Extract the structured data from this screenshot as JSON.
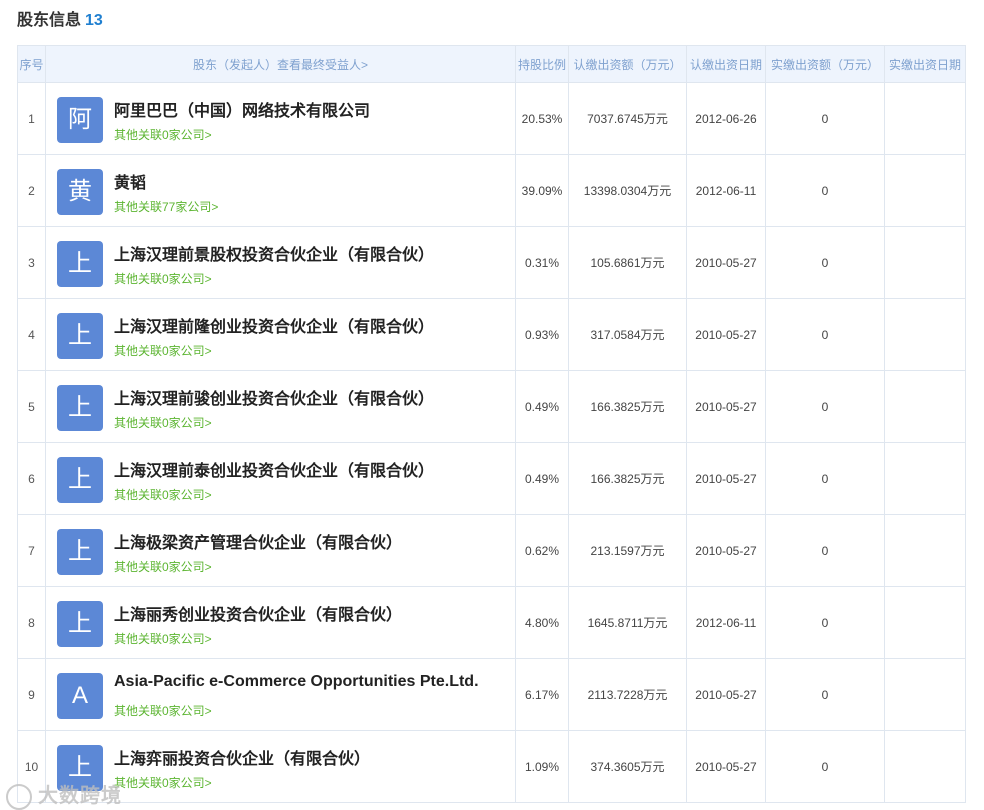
{
  "header": {
    "title": "股东信息",
    "count": "13"
  },
  "table": {
    "columns": [
      "序号",
      "股东（发起人）查看最终受益人>",
      "持股比例",
      "认缴出资额（万元）",
      "认缴出资日期",
      "实缴出资额（万元）",
      "实缴出资日期"
    ],
    "rows": [
      {
        "seq": "1",
        "avatar": "阿",
        "name": "阿里巴巴（中国）网络技术有限公司",
        "link": "其他关联0家公司>",
        "ratio": "20.53%",
        "amount": "7037.6745万元",
        "date": "2012-06-26",
        "paid": "0",
        "paid_date": ""
      },
      {
        "seq": "2",
        "avatar": "黄",
        "name": "黄韬",
        "link": "其他关联77家公司>",
        "ratio": "39.09%",
        "amount": "13398.0304万元",
        "date": "2012-06-11",
        "paid": "0",
        "paid_date": ""
      },
      {
        "seq": "3",
        "avatar": "上",
        "name": "上海汉理前景股权投资合伙企业（有限合伙）",
        "link": "其他关联0家公司>",
        "ratio": "0.31%",
        "amount": "105.6861万元",
        "date": "2010-05-27",
        "paid": "0",
        "paid_date": ""
      },
      {
        "seq": "4",
        "avatar": "上",
        "name": "上海汉理前隆创业投资合伙企业（有限合伙）",
        "link": "其他关联0家公司>",
        "ratio": "0.93%",
        "amount": "317.0584万元",
        "date": "2010-05-27",
        "paid": "0",
        "paid_date": ""
      },
      {
        "seq": "5",
        "avatar": "上",
        "name": "上海汉理前骏创业投资合伙企业（有限合伙）",
        "link": "其他关联0家公司>",
        "ratio": "0.49%",
        "amount": "166.3825万元",
        "date": "2010-05-27",
        "paid": "0",
        "paid_date": ""
      },
      {
        "seq": "6",
        "avatar": "上",
        "name": "上海汉理前泰创业投资合伙企业（有限合伙）",
        "link": "其他关联0家公司>",
        "ratio": "0.49%",
        "amount": "166.3825万元",
        "date": "2010-05-27",
        "paid": "0",
        "paid_date": ""
      },
      {
        "seq": "7",
        "avatar": "上",
        "name": "上海极梁资产管理合伙企业（有限合伙）",
        "link": "其他关联0家公司>",
        "ratio": "0.62%",
        "amount": "213.1597万元",
        "date": "2010-05-27",
        "paid": "0",
        "paid_date": ""
      },
      {
        "seq": "8",
        "avatar": "上",
        "name": "上海丽秀创业投资合伙企业（有限合伙）",
        "link": "其他关联0家公司>",
        "ratio": "4.80%",
        "amount": "1645.8711万元",
        "date": "2012-06-11",
        "paid": "0",
        "paid_date": ""
      },
      {
        "seq": "9",
        "avatar": "A",
        "name": "Asia-Pacific e-Commerce Opportunities Pte.Ltd.",
        "link": "其他关联0家公司>",
        "ratio": "6.17%",
        "amount": "2113.7228万元",
        "date": "2010-05-27",
        "paid": "0",
        "paid_date": ""
      },
      {
        "seq": "10",
        "avatar": "上",
        "name": "上海弈丽投资合伙企业（有限合伙）",
        "link": "其他关联0家公司>",
        "ratio": "1.09%",
        "amount": "374.3605万元",
        "date": "2010-05-27",
        "paid": "0",
        "paid_date": ""
      }
    ]
  },
  "watermark": {
    "text": "大数跨境"
  },
  "colors": {
    "avatar": "#5c88d6",
    "link": "#5cb531",
    "count": "#1f7fd0",
    "header_bg": "#eef4fd"
  }
}
